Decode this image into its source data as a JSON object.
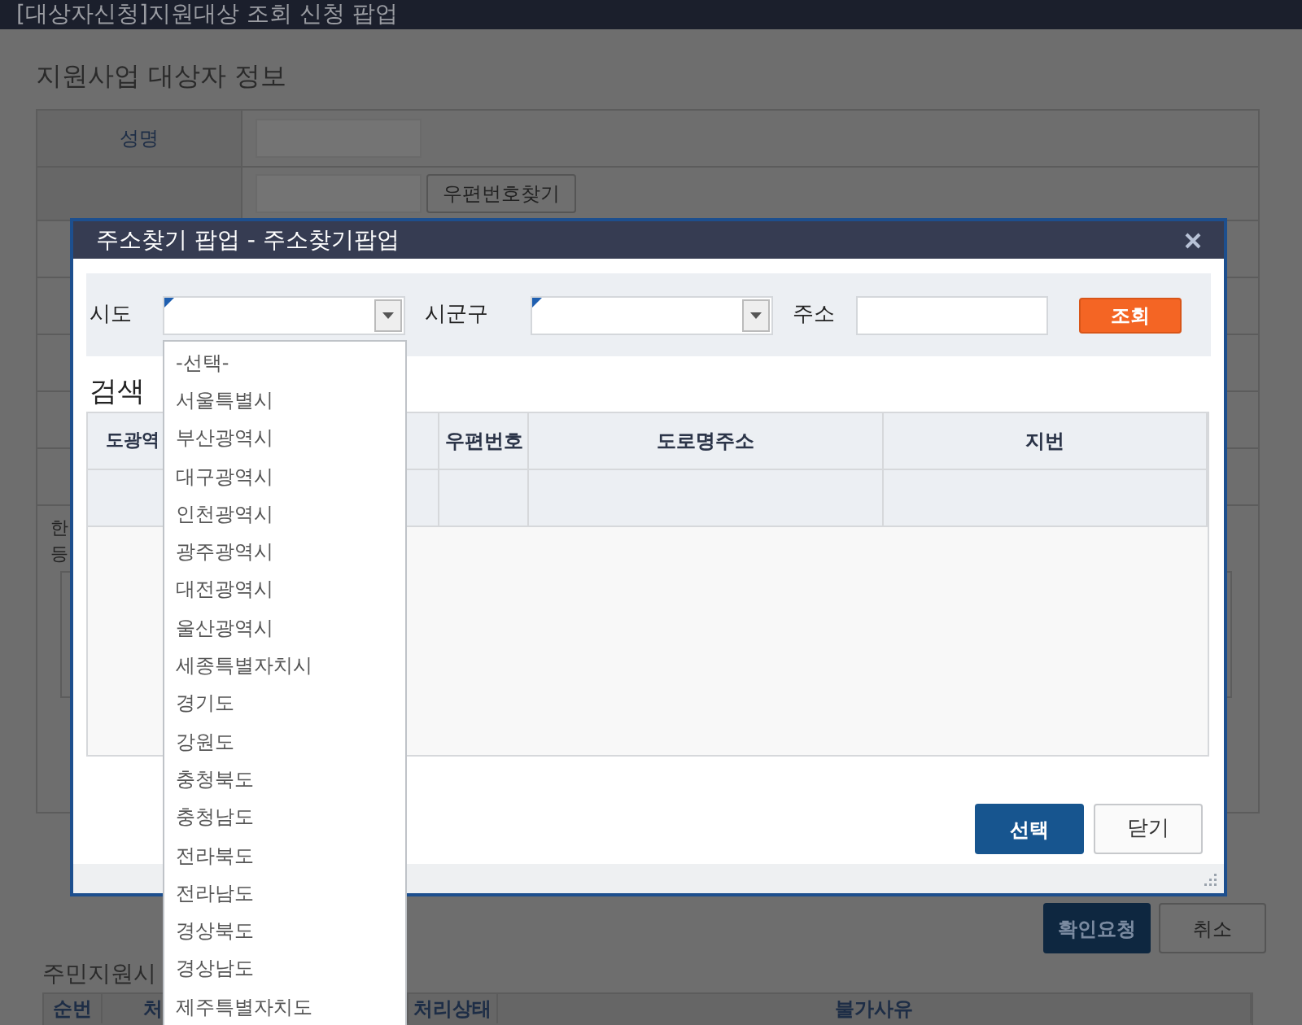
{
  "window": {
    "title": "[대상자신청]지원대상 조회 신청 팝업"
  },
  "page": {
    "section_title": "지원사업 대상자 정보",
    "name_label": "성명",
    "postcode_button": "우편번호찾기",
    "partial_texts": [
      "한",
      "등"
    ],
    "actions": [
      {
        "label": "확인요청",
        "kind": "primary"
      },
      {
        "label": "취소",
        "kind": "secondary"
      }
    ],
    "list_title": "주민지원시",
    "list_columns": [
      "순번",
      "처",
      "처리상태",
      "불가사유"
    ]
  },
  "dialog": {
    "title": "주소찾기 팝업 - 주소찾기팝업",
    "filters": [
      {
        "label": "시도",
        "kind": "select",
        "required": true
      },
      {
        "label": "시군구",
        "kind": "select",
        "required": true
      },
      {
        "label": "주소",
        "kind": "input"
      }
    ],
    "search_button": "조회",
    "results_title": "검색",
    "columns": [
      "도광역",
      "우편번호",
      "도로명주소",
      "지번"
    ],
    "buttons": [
      {
        "label": "선택",
        "kind": "primary"
      },
      {
        "label": "닫기",
        "kind": "secondary"
      }
    ]
  },
  "dropdown": {
    "options": [
      "-선택-",
      "서울특별시",
      "부산광역시",
      "대구광역시",
      "인천광역시",
      "광주광역시",
      "대전광역시",
      "울산광역시",
      "세종특별자치시",
      "경기도",
      "강원도",
      "충청북도",
      "충청남도",
      "전라북도",
      "전라남도",
      "경상북도",
      "경상남도",
      "제주특별자치도"
    ]
  }
}
